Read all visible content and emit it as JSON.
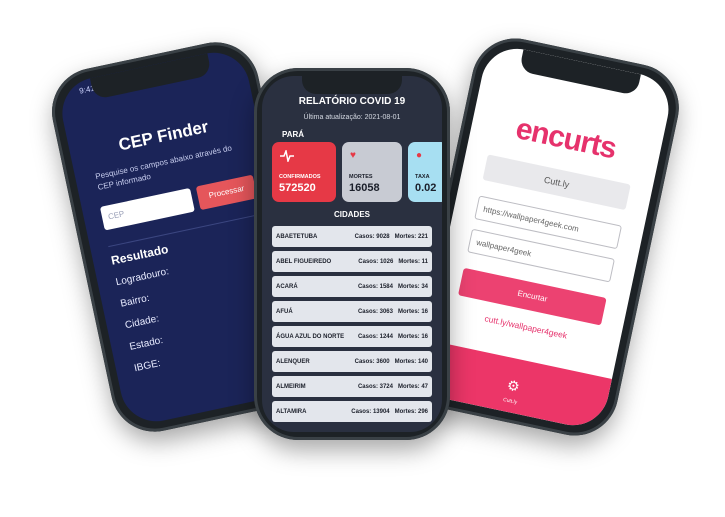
{
  "cep_app": {
    "status_time": "9:41",
    "title": "CEP Finder",
    "description": "Pesquise os campos abaixo através do CEP informado",
    "input_placeholder": "CEP",
    "button_label": "Processar",
    "result_heading": "Resultado",
    "fields": [
      "Logradouro:",
      "Bairro:",
      "Cidade:",
      "Estado:",
      "IBGE:"
    ]
  },
  "covid_app": {
    "title": "RELATÓRIO COVID 19",
    "last_update": "Última atualização: 2021-08-01",
    "state": "PARÁ",
    "cards": [
      {
        "label": "CONFIRMADOS",
        "value": "572520",
        "icon": "heartbeat-icon",
        "color": "#e63946"
      },
      {
        "label": "MORTES",
        "value": "16058",
        "icon": "heart-icon",
        "color": "#c8cbd3"
      },
      {
        "label": "TAXA",
        "value": "0.02",
        "icon": "alert-icon",
        "color": "#a7dff2"
      }
    ],
    "cities_heading": "CIDADES",
    "cities": [
      {
        "name": "ABAETETUBA",
        "cases": "Casos: 9028",
        "deaths": "Mortes: 221"
      },
      {
        "name": "ABEL FIGUEIREDO",
        "cases": "Casos: 1026",
        "deaths": "Mortes: 11"
      },
      {
        "name": "ACARÁ",
        "cases": "Casos: 1584",
        "deaths": "Mortes: 34"
      },
      {
        "name": "AFUÁ",
        "cases": "Casos: 3063",
        "deaths": "Mortes: 16"
      },
      {
        "name": "ÁGUA AZUL DO NORTE",
        "cases": "Casos: 1244",
        "deaths": "Mortes: 16"
      },
      {
        "name": "ALENQUER",
        "cases": "Casos: 3600",
        "deaths": "Mortes: 140"
      },
      {
        "name": "ALMEIRIM",
        "cases": "Casos: 3724",
        "deaths": "Mortes: 47"
      },
      {
        "name": "ALTAMIRA",
        "cases": "Casos: 13904",
        "deaths": "Mortes: 296"
      }
    ]
  },
  "encurts_app": {
    "logo": "encurts",
    "provider": "Cutt.ly",
    "url_value": "https://wallpaper4geek.com",
    "alias_value": "wallpaper4geek",
    "button_label": "Encurtar",
    "result_link": "cutt.ly/wallpaper4geek",
    "bottom_label": "Cutt.ly",
    "brand_color": "#e6326c"
  }
}
